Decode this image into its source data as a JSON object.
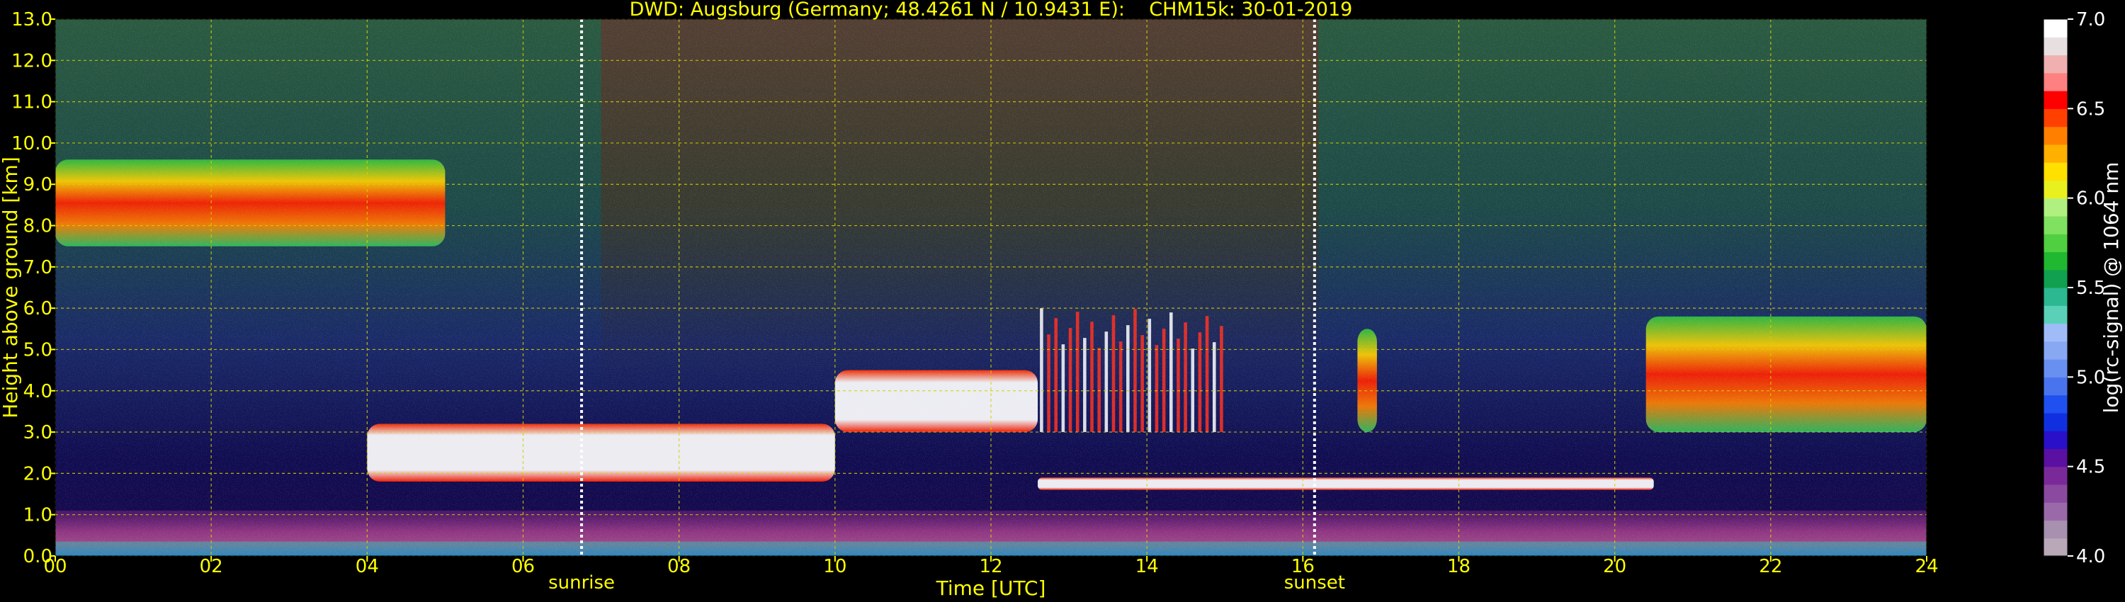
{
  "chart_data": {
    "type": "heatmap",
    "title": "DWD: Augsburg (Germany; 48.4261 N / 10.9431 E):    CHM15k: 30-01-2019",
    "xlabel": "Time [UTC]",
    "ylabel": "Height above ground [km]",
    "xlim": [
      0,
      24
    ],
    "ylim": [
      0,
      13
    ],
    "x_ticks": [
      "00",
      "02",
      "04",
      "06",
      "08",
      "10",
      "12",
      "14",
      "16",
      "18",
      "20",
      "22",
      "24"
    ],
    "y_ticks": [
      "0.0",
      "1.0",
      "2.0",
      "3.0",
      "4.0",
      "5.0",
      "6.0",
      "7.0",
      "8.0",
      "9.0",
      "10.0",
      "11.0",
      "12.0",
      "13.0"
    ],
    "grid": true,
    "annotations": [
      {
        "text": "sunrise",
        "x": 6.75
      },
      {
        "text": "sunset",
        "x": 16.15
      }
    ],
    "colorbar": {
      "label": "log(rc-signal) @ 1064 nm",
      "range": [
        4.0,
        7.0
      ],
      "ticks": [
        "4.0",
        "4.5",
        "5.0",
        "5.5",
        "6.0",
        "6.5",
        "7.0"
      ],
      "colors": [
        "#b8a8b8",
        "#a890b0",
        "#9a6aa8",
        "#8a4aa0",
        "#7a2a98",
        "#5a10a0",
        "#2a10c8",
        "#1030e0",
        "#2050f0",
        "#4a74ee",
        "#6890f0",
        "#88a8f4",
        "#a0bcf8",
        "#5ad0b8",
        "#2cb890",
        "#10a050",
        "#20b830",
        "#50d040",
        "#80e060",
        "#b0f080",
        "#e8f020",
        "#ffe000",
        "#ffb000",
        "#ff8000",
        "#ff4000",
        "#ff0000",
        "#ff8080",
        "#f0b0b0",
        "#e8e0e0",
        "#ffffff"
      ]
    },
    "background": {
      "sky_noise_colors": [
        "#2a5a40",
        "#3a2a20",
        "#1a2060",
        "#101060"
      ],
      "low_layer_colors": [
        "#6a3080",
        "#a04080",
        "#2050e0",
        "#30c0b0"
      ]
    },
    "features": [
      {
        "name": "cirrus",
        "t": [
          0.0,
          5.0
        ],
        "z": [
          7.5,
          9.6
        ],
        "intensity": "high"
      },
      {
        "name": "cloud_layer",
        "t": [
          4.0,
          10.0
        ],
        "z": [
          1.8,
          3.2
        ],
        "intensity": "saturated"
      },
      {
        "name": "cloud_layer",
        "t": [
          10.0,
          12.6
        ],
        "z": [
          3.0,
          4.5
        ],
        "intensity": "saturated"
      },
      {
        "name": "precip_streaks",
        "t": [
          12.6,
          15.0
        ],
        "z": [
          3.0,
          6.0
        ],
        "intensity": "high"
      },
      {
        "name": "column",
        "t": [
          16.7,
          16.95
        ],
        "z": [
          3.0,
          5.5
        ],
        "intensity": "high"
      },
      {
        "name": "boundary_layer_top",
        "t": [
          12.6,
          20.5
        ],
        "z": [
          1.6,
          1.9
        ],
        "intensity": "saturated"
      },
      {
        "name": "cloud_layer",
        "t": [
          20.4,
          24.0
        ],
        "z": [
          3.0,
          5.8
        ],
        "intensity": "high"
      }
    ]
  }
}
